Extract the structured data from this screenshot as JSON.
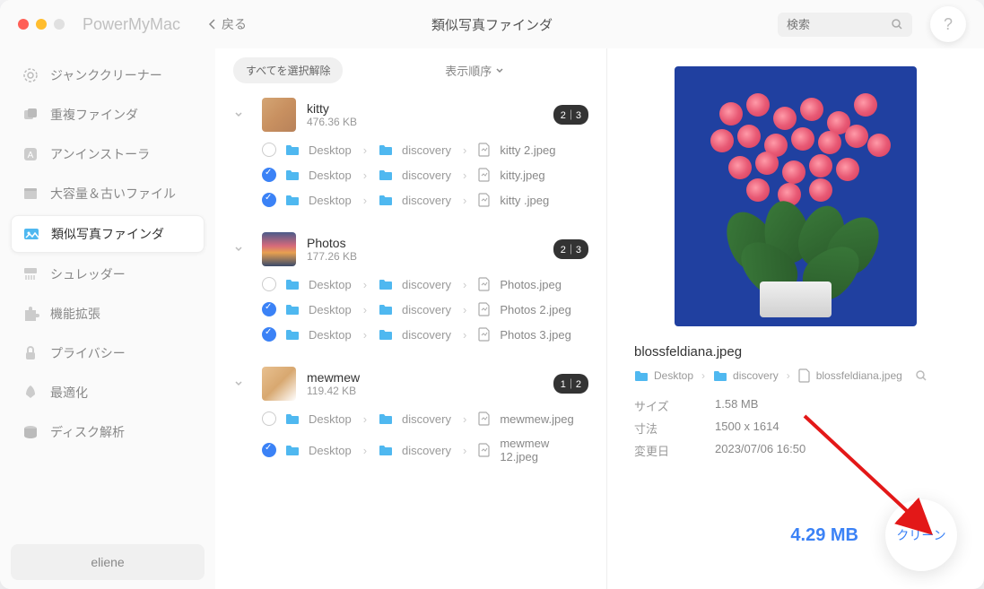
{
  "app_title": "PowerMyMac",
  "back_label": "戻る",
  "page_title": "類似写真ファインダ",
  "search_placeholder": "検索",
  "help_label": "?",
  "sidebar": {
    "items": [
      {
        "label": "ジャンククリーナー"
      },
      {
        "label": "重複ファインダ"
      },
      {
        "label": "アンインストーラ"
      },
      {
        "label": "大容量＆古いファイル"
      },
      {
        "label": "類似写真ファインダ"
      },
      {
        "label": "シュレッダー"
      },
      {
        "label": "機能拡張"
      },
      {
        "label": "プライバシー"
      },
      {
        "label": "最適化"
      },
      {
        "label": "ディスク解析"
      }
    ],
    "user": "eliene"
  },
  "toolbar": {
    "deselect_label": "すべてを選択解除",
    "sort_label": "表示順序"
  },
  "groups": [
    {
      "name": "kitty",
      "size": "476.36 KB",
      "badge": "2｜3",
      "files": [
        {
          "checked": false,
          "path": [
            "Desktop",
            "discovery"
          ],
          "name": "kitty 2.jpeg"
        },
        {
          "checked": true,
          "path": [
            "Desktop",
            "discovery"
          ],
          "name": "kitty.jpeg"
        },
        {
          "checked": true,
          "path": [
            "Desktop",
            "discovery"
          ],
          "name": "kitty .jpeg"
        }
      ]
    },
    {
      "name": "Photos",
      "size": "177.26 KB",
      "badge": "2｜3",
      "files": [
        {
          "checked": false,
          "path": [
            "Desktop",
            "discovery"
          ],
          "name": "Photos.jpeg"
        },
        {
          "checked": true,
          "path": [
            "Desktop",
            "discovery"
          ],
          "name": "Photos 2.jpeg"
        },
        {
          "checked": true,
          "path": [
            "Desktop",
            "discovery"
          ],
          "name": "Photos 3.jpeg"
        }
      ]
    },
    {
      "name": "mewmew",
      "size": "119.42 KB",
      "badge": "1｜2",
      "files": [
        {
          "checked": false,
          "path": [
            "Desktop",
            "discovery"
          ],
          "name": "mewmew.jpeg"
        },
        {
          "checked": true,
          "path": [
            "Desktop",
            "discovery"
          ],
          "name": "mewmew 12.jpeg"
        }
      ]
    }
  ],
  "detail": {
    "filename": "blossfeldiana.jpeg",
    "path": [
      "Desktop",
      "discovery",
      "blossfeldiana.jpeg"
    ],
    "size_label": "サイズ",
    "size_value": "1.58 MB",
    "dim_label": "寸法",
    "dim_value": "1500 x 1614",
    "mod_label": "変更日",
    "mod_value": "2023/07/06 16:50"
  },
  "footer": {
    "total_size": "4.29 MB",
    "clean_label": "クリーン"
  }
}
